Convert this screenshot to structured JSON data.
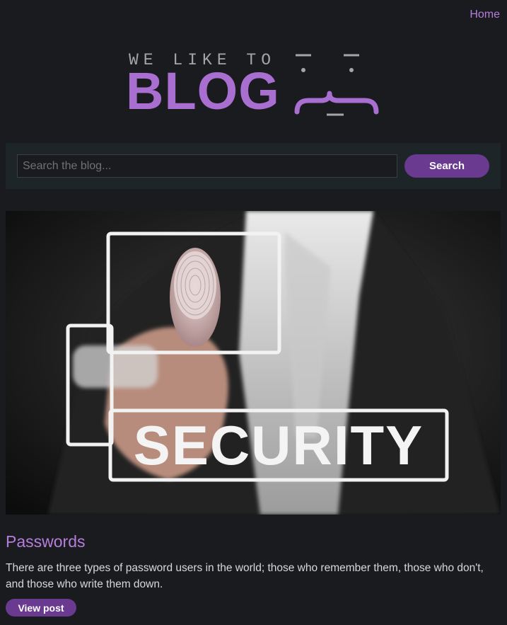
{
  "nav": {
    "home_label": "Home"
  },
  "logo": {
    "tagline": "WE LIKE TO",
    "wordmark": "BLOG",
    "face_icon": "face-icon"
  },
  "search": {
    "placeholder": "Search the blog...",
    "value": "",
    "button_label": "Search"
  },
  "post": {
    "image_caption": "SECURITY",
    "title": "Passwords",
    "summary": "There are three types of password users in the world; those who remember them, those who don't, and those who write them down.",
    "button_label": "View post"
  },
  "colors": {
    "background": "#1a1b1f",
    "accent": "#b57edc",
    "button": "#6a3a91",
    "search_panel": "#1e2528"
  }
}
